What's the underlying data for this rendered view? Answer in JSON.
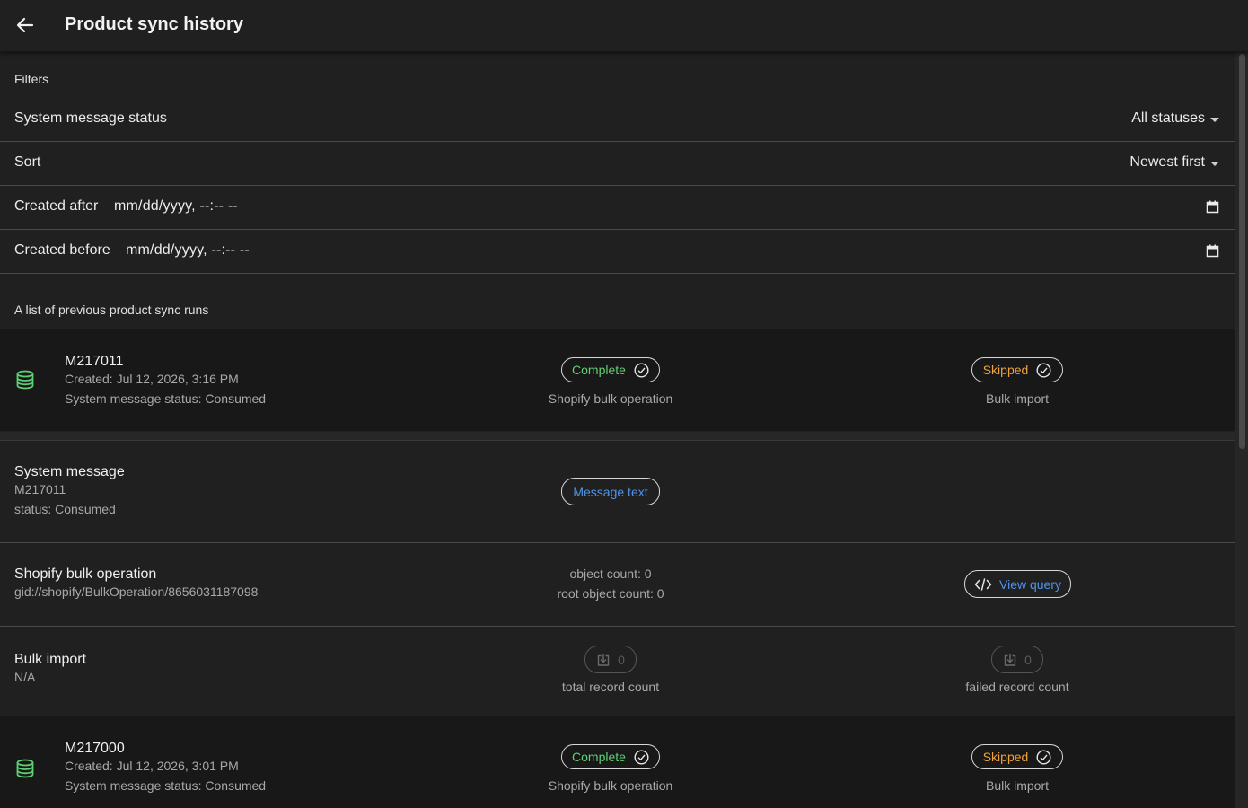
{
  "header": {
    "title": "Product sync history"
  },
  "filters": {
    "caption": "Filters",
    "status_label": "System message status",
    "status_value": "All statuses",
    "sort_label": "Sort",
    "sort_value": "Newest first",
    "created_after_label": "Created after",
    "created_after_value": "mm/dd/yyyy, --:-- --",
    "created_before_label": "Created before",
    "created_before_value": "mm/dd/yyyy, --:-- --"
  },
  "list": {
    "caption": "A list of previous product sync runs",
    "runs": [
      {
        "id": "M217011",
        "created": "Created: Jul 12, 2026, 3:16 PM",
        "status": "System message status: Consumed",
        "op_status": "Complete",
        "op_label": "Shopify bulk operation",
        "import_status": "Skipped",
        "import_label": "Bulk import"
      },
      {
        "id": "M217000",
        "created": "Created: Jul 12, 2026, 3:01 PM",
        "status": "System message status: Consumed",
        "op_status": "Complete",
        "op_label": "Shopify bulk operation",
        "import_status": "Skipped",
        "import_label": "Bulk import"
      }
    ]
  },
  "details": {
    "system_message": {
      "title": "System message",
      "id": "M217011",
      "status": "status: Consumed",
      "button": "Message text"
    },
    "bulk_operation": {
      "title": "Shopify bulk operation",
      "gid": "gid://shopify/BulkOperation/8656031187098",
      "object_count": "object count: 0",
      "root_object_count": "root object count: 0",
      "button": "View query"
    },
    "bulk_import": {
      "title": "Bulk import",
      "value": "N/A",
      "total_count": "0",
      "total_label": "total record count",
      "failed_count": "0",
      "failed_label": "failed record count"
    }
  },
  "colors": {
    "complete": "#5fcf74",
    "skipped": "#f0a33c",
    "link": "#4f93ea"
  },
  "icons": [
    "arrow-back-icon",
    "calendar-icon",
    "database-icon",
    "check-circle-icon",
    "code-icon",
    "download-icon"
  ]
}
